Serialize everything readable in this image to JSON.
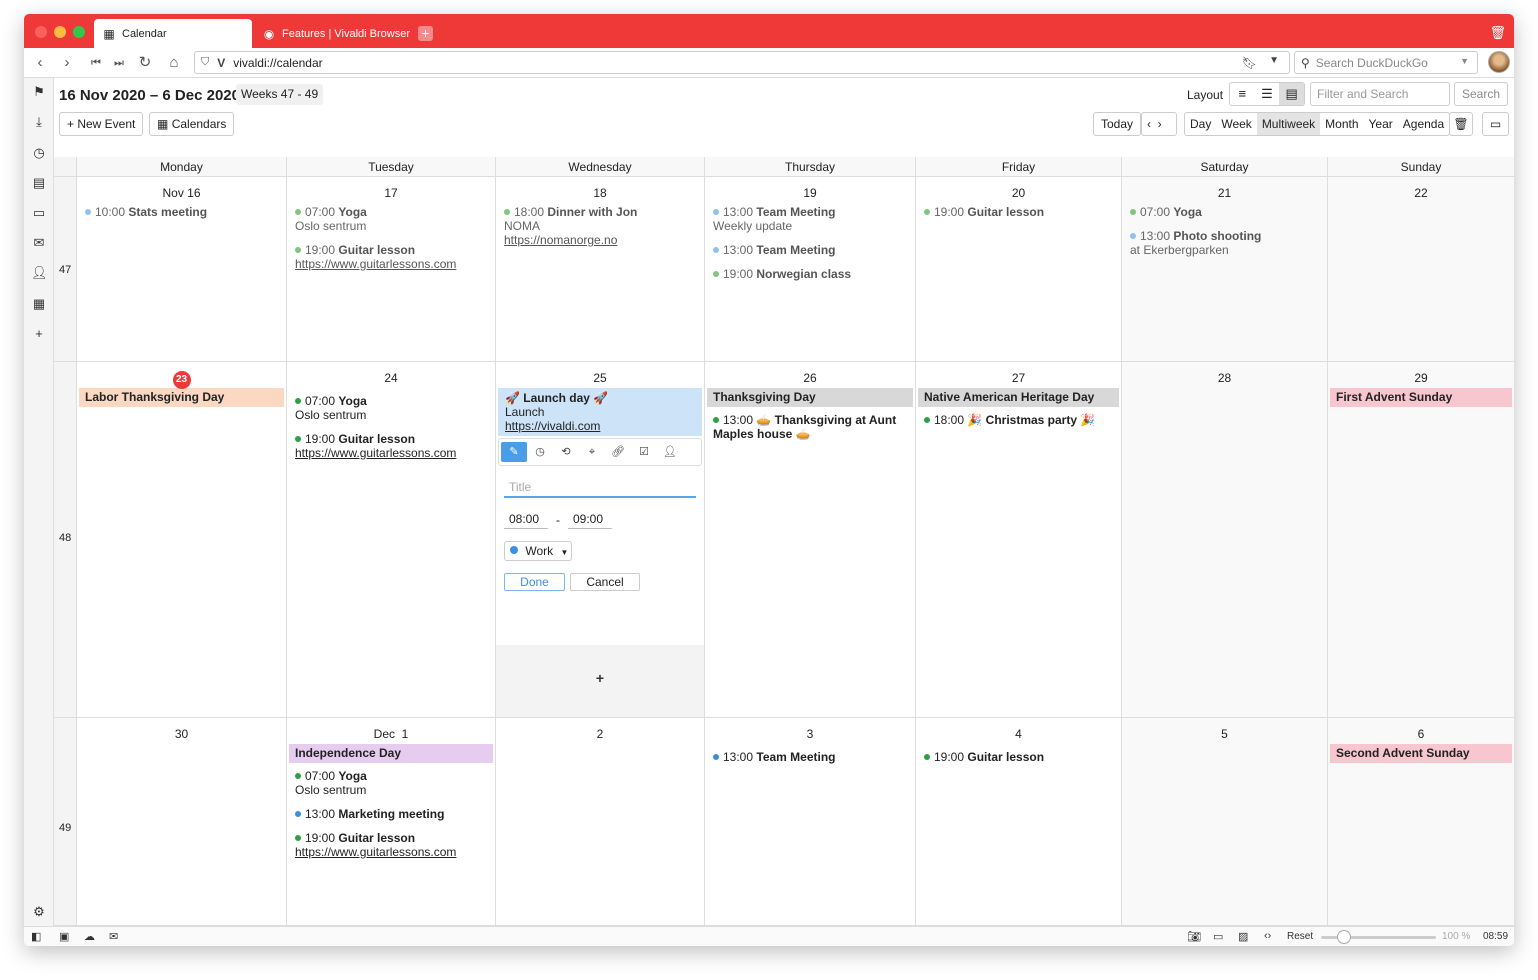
{
  "browser": {
    "tabs": [
      {
        "label": "Calendar",
        "icon": "calendar-icon"
      },
      {
        "label": "Features | Vivaldi Browser",
        "icon": "vivaldi-icon"
      }
    ],
    "url": "vivaldi://calendar",
    "search_placeholder": "Search DuckDuckGo",
    "accent": "#ef3939"
  },
  "calendar": {
    "range_title": "16 Nov 2020 – 6 Dec 2020",
    "weeks_label": "Weeks 47 - 49",
    "layout_label": "Layout",
    "filter_placeholder": "Filter and Search",
    "search_label": "Search",
    "new_event_label": "+ New Event",
    "calendars_label": "Calendars",
    "today_label": "Today",
    "views": [
      "Day",
      "Week",
      "Multiweek",
      "Month",
      "Year",
      "Agenda"
    ],
    "active_view": "Multiweek",
    "weekdays": [
      "Monday",
      "Tuesday",
      "Wednesday",
      "Thursday",
      "Friday",
      "Saturday",
      "Sunday"
    ],
    "week_numbers": [
      "47",
      "48",
      "49"
    ],
    "days": {
      "w1": [
        "Nov 16",
        "17",
        "18",
        "19",
        "20",
        "21",
        "22"
      ],
      "w2": [
        "23",
        "24",
        "25",
        "26",
        "27",
        "28",
        "29"
      ],
      "w3": [
        "30",
        "Dec  1",
        "2",
        "3",
        "4",
        "5",
        "6"
      ]
    },
    "events": {
      "nov16": {
        "time": "10:00",
        "title": "Stats meeting"
      },
      "nov17a": {
        "time": "07:00",
        "title": "Yoga",
        "location": "Oslo sentrum"
      },
      "nov17b": {
        "time": "19:00",
        "title": "Guitar lesson",
        "link": "https://www.guitarlessons.com"
      },
      "nov18": {
        "time": "18:00",
        "title": "Dinner with Jon",
        "location": "NOMA",
        "link": "https://nomanorge.no"
      },
      "nov19a": {
        "time": "13:00",
        "title": "Team Meeting",
        "note": "Weekly update"
      },
      "nov19b": {
        "time": "13:00",
        "title": "Team Meeting"
      },
      "nov19c": {
        "time": "19:00",
        "title": "Norwegian class"
      },
      "nov20": {
        "time": "19:00",
        "title": "Guitar lesson"
      },
      "nov21a": {
        "time": "07:00",
        "title": "Yoga"
      },
      "nov21b": {
        "time": "13:00",
        "title": "Photo shooting",
        "location": "at Ekerbergparken"
      },
      "nov23_allday": "Labor Thanksgiving Day",
      "nov24a": {
        "time": "07:00",
        "title": "Yoga",
        "location": "Oslo sentrum"
      },
      "nov24b": {
        "time": "19:00",
        "title": "Guitar lesson",
        "link": "https://www.guitarlessons.com"
      },
      "nov25": {
        "title": "🚀 Launch day 🚀",
        "note": "Launch",
        "link": "https://vivaldi.com"
      },
      "nov26_allday": "Thanksgiving Day",
      "nov26": {
        "time": "13:00",
        "title": "🥧 Thanksgiving at Aunt Maples house 🥧"
      },
      "nov27_allday": "Native American Heritage Day",
      "nov27": {
        "time": "18:00",
        "title": "🎉 Christmas party 🎉"
      },
      "nov29_allday": "First Advent Sunday",
      "dec1_allday": "Independence Day",
      "dec1a": {
        "time": "07:00",
        "title": "Yoga",
        "location": "Oslo sentrum"
      },
      "dec1b": {
        "time": "13:00",
        "title": "Marketing meeting"
      },
      "dec1c": {
        "time": "19:00",
        "title": "Guitar lesson",
        "link": "https://www.guitarlessons.com"
      },
      "dec3": {
        "time": "13:00",
        "title": "Team Meeting"
      },
      "dec4": {
        "time": "19:00",
        "title": "Guitar lesson"
      },
      "dec6_allday": "Second Advent Sunday"
    },
    "editor": {
      "title_placeholder": "Title",
      "start": "08:00",
      "sep": "-",
      "end": "09:00",
      "calendar": "Work",
      "done": "Done",
      "cancel": "Cancel",
      "add": "+"
    },
    "colors": {
      "green": "#2ea043",
      "blue": "#3b8fe0",
      "holiday_orange": "#fbd8c2",
      "holiday_gray": "#d8d8d8",
      "holiday_pink": "#f7c6cf",
      "holiday_purple": "#e6cdf0"
    }
  },
  "statusbar": {
    "reset": "Reset",
    "zoom": "100 %",
    "clock": "08:59"
  }
}
